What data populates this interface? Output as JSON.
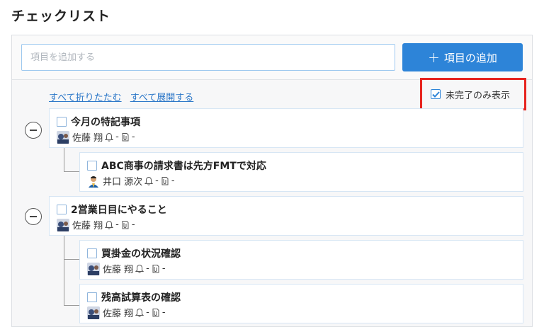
{
  "page": {
    "title": "チェックリスト"
  },
  "add_form": {
    "placeholder": "項目を追加する",
    "button_label": "項目の追加",
    "button_icon": "plus-icon"
  },
  "actions": {
    "collapse_all": "すべて折りたたむ",
    "expand_all": "すべて展開する"
  },
  "filter": {
    "label": "未完了のみ表示",
    "checked": true
  },
  "groups": [
    {
      "title": "今月の特記事項",
      "assignee": "佐藤 翔",
      "reminder": "-",
      "attachment": "-",
      "children": [
        {
          "title": "ABC商事の請求書は先方FMTで対応",
          "assignee": "井口 源次",
          "reminder": "-",
          "attachment": "-"
        }
      ]
    },
    {
      "title": "2営業日目にやること",
      "assignee": "佐藤 翔",
      "reminder": "-",
      "attachment": "-",
      "children": [
        {
          "title": "買掛金の状況確認",
          "assignee": "佐藤 翔",
          "reminder": "-",
          "attachment": "-"
        },
        {
          "title": "残高試算表の確認",
          "assignee": "佐藤 翔",
          "reminder": "-",
          "attachment": "-"
        }
      ]
    }
  ],
  "colors": {
    "primary": "#2d84d8",
    "highlight": "#e7241f",
    "link": "#2c77c8"
  }
}
